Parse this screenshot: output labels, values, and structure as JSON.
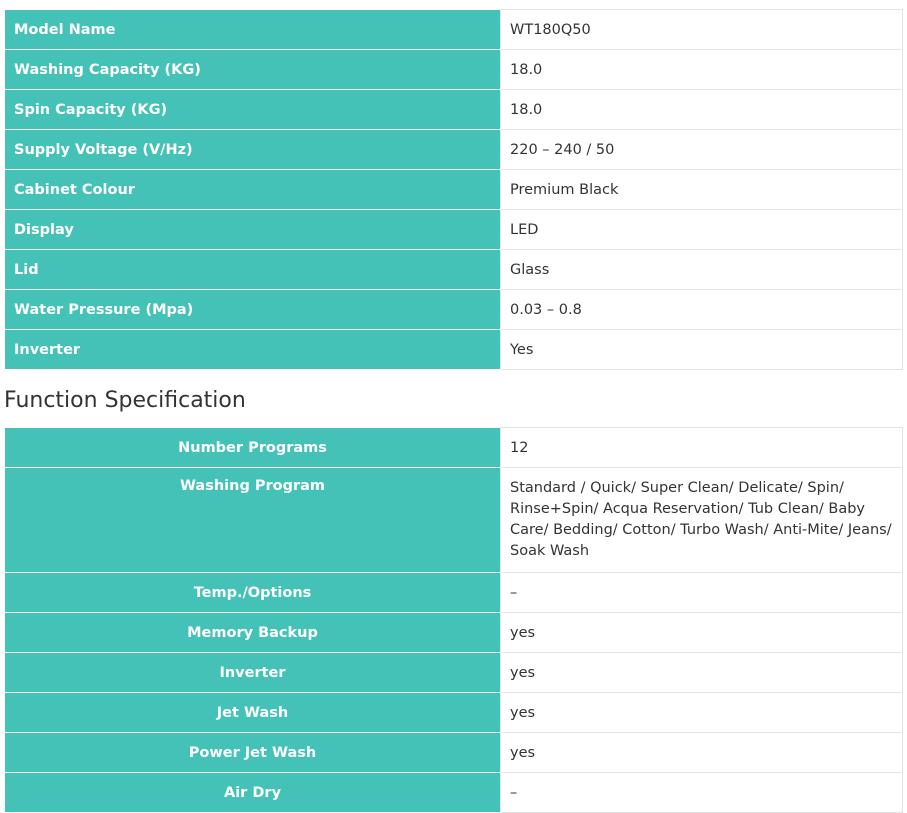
{
  "general_specs": [
    {
      "label": "Model Name",
      "value": "WT180Q50"
    },
    {
      "label": "Washing Capacity (KG)",
      "value": "18.0"
    },
    {
      "label": "Spin Capacity (KG)",
      "value": "18.0"
    },
    {
      "label": "Supply Voltage (V/Hz)",
      "value": "220 – 240 / 50"
    },
    {
      "label": "Cabinet Colour",
      "value": "Premium Black"
    },
    {
      "label": "Display",
      "value": "LED"
    },
    {
      "label": "Lid",
      "value": "Glass"
    },
    {
      "label": "Water Pressure (Mpa)",
      "value": "0.03 – 0.8"
    },
    {
      "label": "Inverter",
      "value": "Yes"
    }
  ],
  "function_section": {
    "heading": "Function Specification",
    "rows": [
      {
        "label": "Number Programs",
        "value": "12"
      },
      {
        "label": "Washing Program",
        "value": "Standard / Quick/ Super Clean/ Delicate/ Spin/ Rinse+Spin/ Acqua Reservation/ Tub Clean/ Baby Care/ Bedding/ Cotton/ Turbo Wash/ Anti-Mite/ Jeans/ Soak Wash"
      },
      {
        "label": "Temp./Options",
        "value": "–"
      },
      {
        "label": "Memory Backup",
        "value": "yes"
      },
      {
        "label": "Inverter",
        "value": "yes"
      },
      {
        "label": "Jet Wash",
        "value": "yes"
      },
      {
        "label": "Power Jet Wash",
        "value": "yes"
      },
      {
        "label": "Air Dry",
        "value": "–"
      }
    ]
  },
  "colors": {
    "label_background": "#45c2b8",
    "label_text": "#ffffff",
    "value_text": "#333333"
  }
}
